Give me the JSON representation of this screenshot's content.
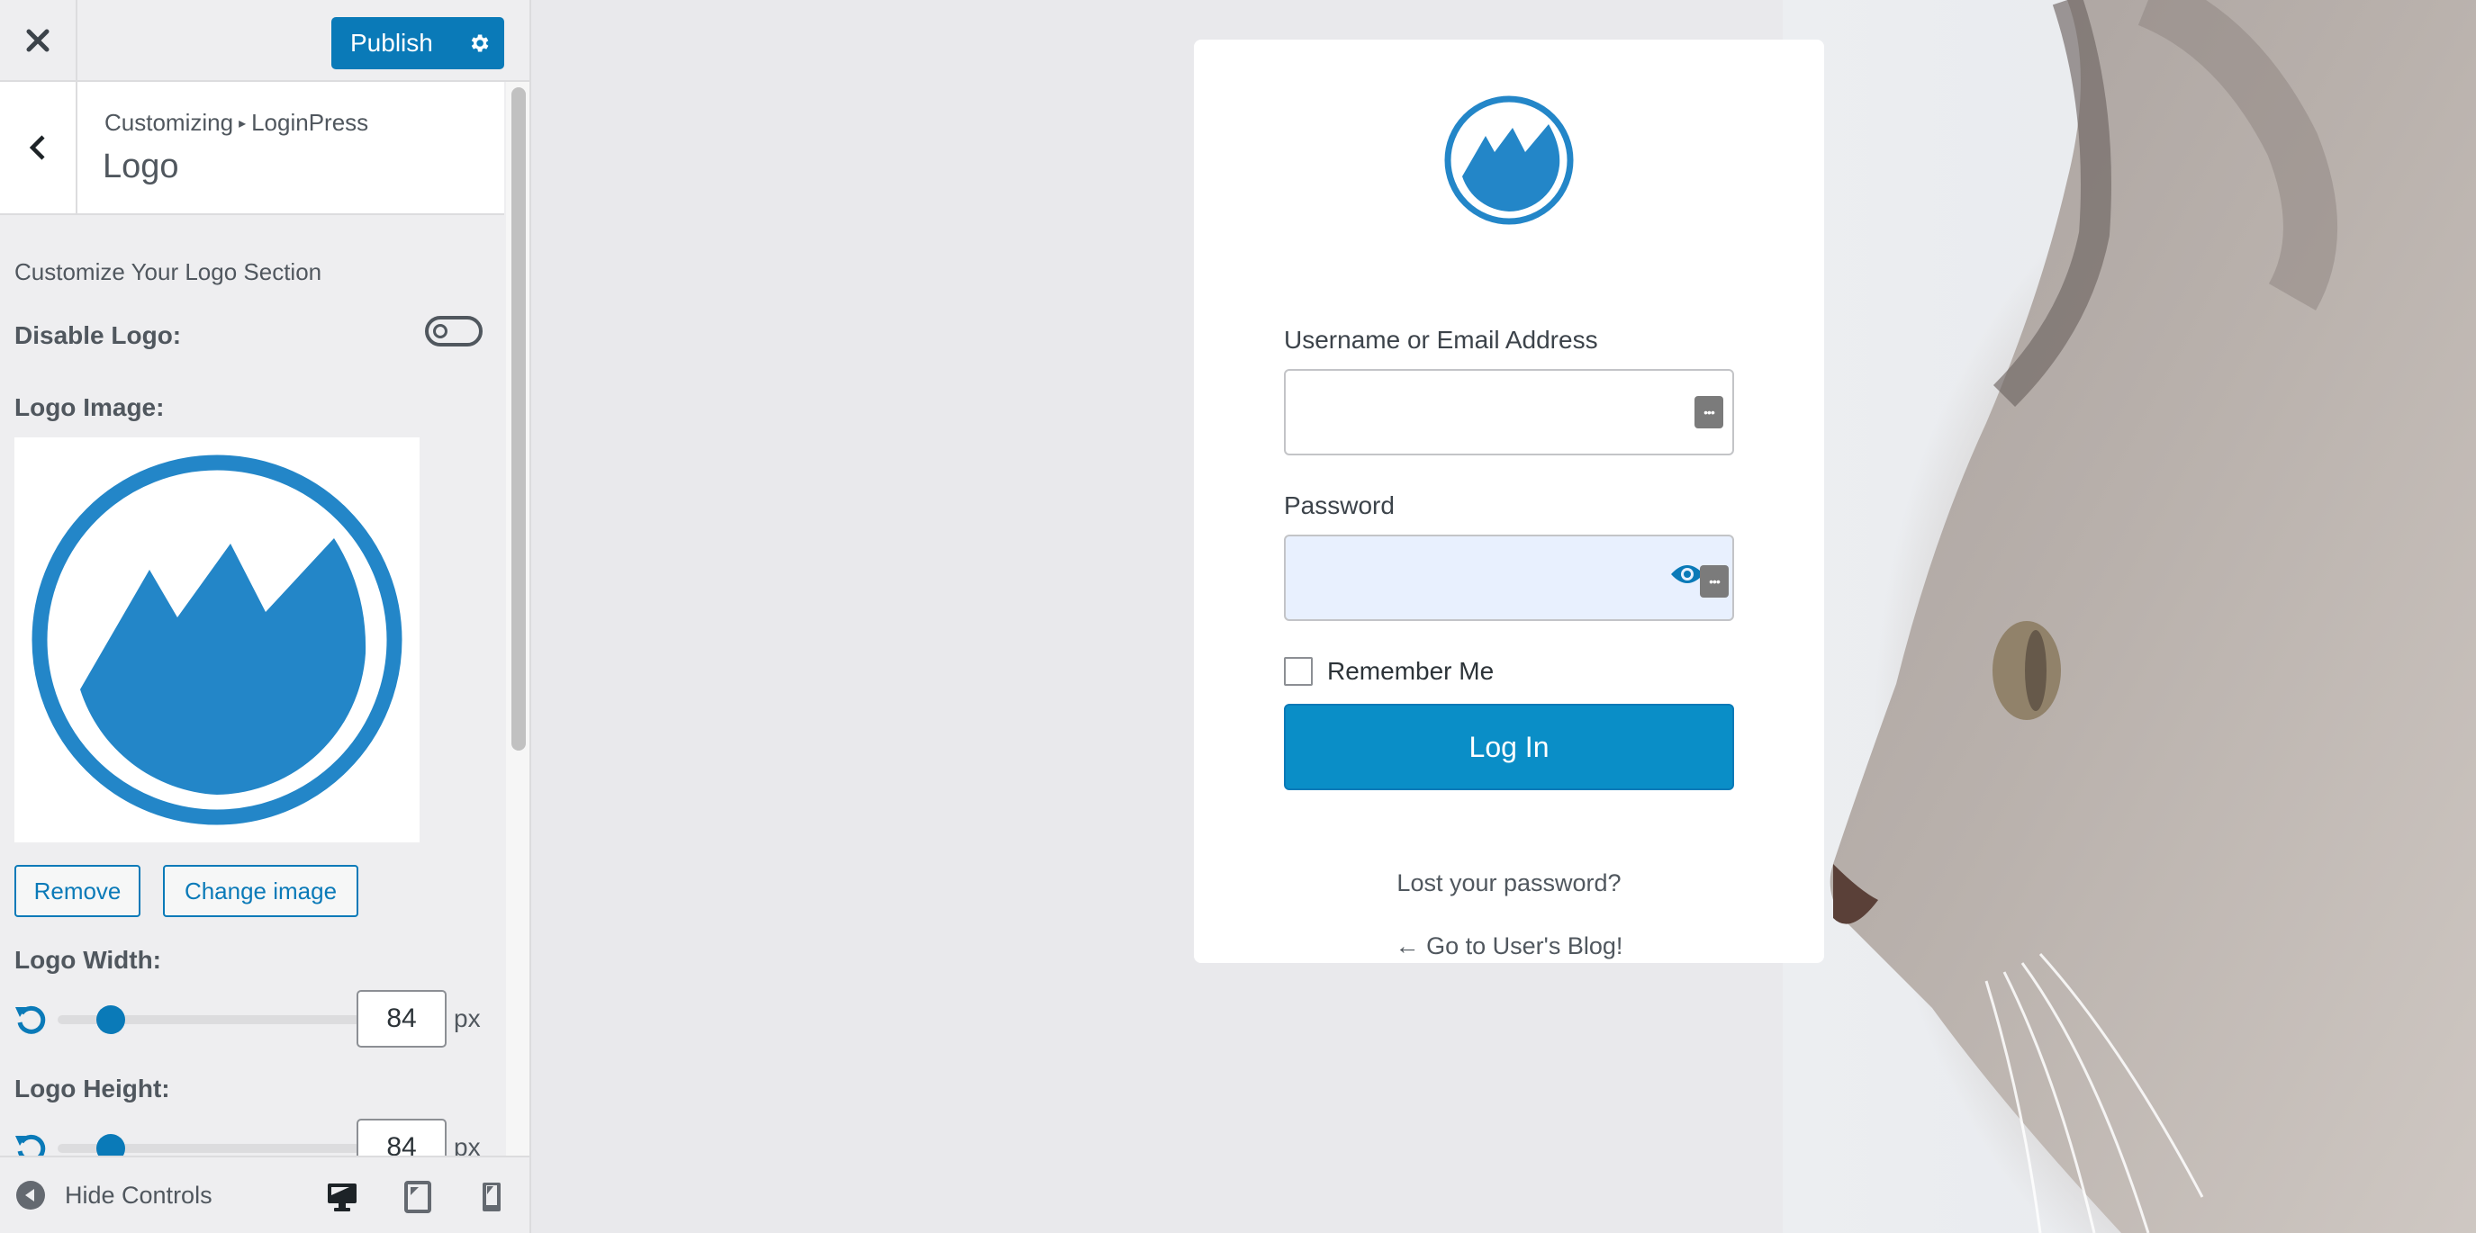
{
  "header": {
    "close_icon": "close-icon",
    "publish_label": "Publish",
    "publish_settings_icon": "gear-icon"
  },
  "section": {
    "breadcrumb_root": "Customizing",
    "breadcrumb_separator": "▸",
    "breadcrumb_parent": "LoginPress",
    "title": "Logo",
    "back_icon": "chevron-left-icon"
  },
  "controls": {
    "description": "Customize Your Logo Section",
    "disable_logo": {
      "label": "Disable Logo:",
      "enabled": false
    },
    "logo_image": {
      "label": "Logo Image:",
      "remove_label": "Remove",
      "change_label": "Change image"
    },
    "logo_width": {
      "label": "Logo Width:",
      "value": "84",
      "unit": "px",
      "slider_fraction": 0.14
    },
    "logo_height": {
      "label": "Logo Height:",
      "value": "84",
      "unit": "px",
      "slider_fraction": 0.14
    }
  },
  "footer": {
    "hide_controls_label": "Hide Controls",
    "devices": [
      {
        "name": "desktop",
        "active": true
      },
      {
        "name": "tablet",
        "active": false
      },
      {
        "name": "mobile",
        "active": false
      }
    ]
  },
  "login_form": {
    "username_label": "Username or Email Address",
    "username_value": "",
    "password_label": "Password",
    "password_value": "",
    "remember_label": "Remember Me",
    "remember_checked": false,
    "login_button": "Log In",
    "lost_password_link": "Lost your password?",
    "back_to_blog_link": "← Go to User's Blog!"
  },
  "colors": {
    "accent": "#0a7ab8",
    "logo_blue": "#2386c8",
    "login_button": "#0a8ec7",
    "password_autofill_bg": "#e8f0fe"
  }
}
